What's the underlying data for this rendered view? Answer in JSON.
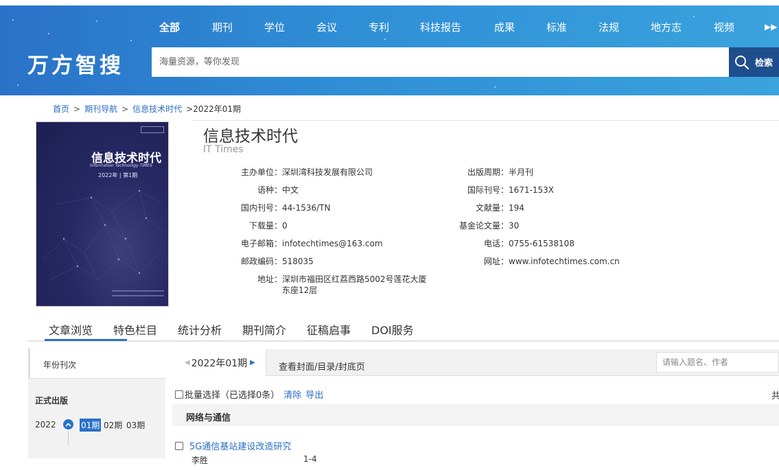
{
  "nav": {
    "items": [
      "全部",
      "期刊",
      "学位",
      "会议",
      "专利",
      "科技报告",
      "成果",
      "标准",
      "法规",
      "地方志",
      "视频"
    ],
    "active_index": 0
  },
  "brand": {
    "logo": "万方智搜"
  },
  "search": {
    "placeholder": "海量资源，等你发现",
    "button_label": "检索"
  },
  "breadcrumb": {
    "home": "首页",
    "journal_nav": "期刊导航",
    "journal": "信息技术时代",
    "current": ">2022年01期"
  },
  "cover": {
    "title": "信息技术时代",
    "subtitle": "Information Technology TIMES",
    "issue": "2022年 | 第1期"
  },
  "journal": {
    "title": "信息技术时代",
    "en_title": "IT Times",
    "info_left": [
      {
        "label": "主办单位：",
        "value": "深圳湾科技发展有限公司"
      },
      {
        "label": "语种：",
        "value": "中文"
      },
      {
        "label": "国内刊号：",
        "value": "44-1536/TN"
      },
      {
        "label": "下载量：",
        "value": "0"
      },
      {
        "label": "电子邮箱：",
        "value": "infotechtimes@163.com"
      },
      {
        "label": "邮政编码：",
        "value": "518035"
      },
      {
        "label": "地址：",
        "value": "深圳市福田区红荔西路5002号莲花大厦",
        "value2": "东座12层"
      }
    ],
    "info_right": [
      {
        "label": "出版周期：",
        "value": "半月刊"
      },
      {
        "label": "国际刊号：",
        "value": "1671-153X"
      },
      {
        "label": "文献量：",
        "value": "194"
      },
      {
        "label": "基金论文量：",
        "value": "30"
      },
      {
        "label": "电话：",
        "value": "0755-61538108"
      },
      {
        "label": "网址：",
        "value": "www.infotechtimes.com.cn"
      }
    ]
  },
  "tabs": [
    "文章浏览",
    "特色栏目",
    "统计分析",
    "期刊简介",
    "征稿启事",
    "DOI服务"
  ],
  "sidebar": {
    "header": "年份刊次",
    "published_label": "正式出版",
    "year": "2022",
    "issues": [
      "01期",
      "02期",
      "03期"
    ],
    "active_issue": 0
  },
  "toolbar": {
    "current_issue": "2022年01期",
    "view_cover": "查看封面/目录/封底页",
    "filter_placeholder": "请输入题名、作者"
  },
  "batch": {
    "label": "批量选择（已选择0条）",
    "clear": "清除",
    "export": "导出",
    "total_prefix": "共"
  },
  "section": {
    "name": "网络与通信"
  },
  "articles": [
    {
      "title": "5G通信基站建设改造研究",
      "author": "李胜",
      "pages": "1-4"
    }
  ],
  "colors": {
    "header_gradient_start": "#2a72c8",
    "header_gradient_end": "#3aa2dd",
    "search_button": "#1e4e8c",
    "link": "#2b6cc4",
    "accent": "#2a72c8"
  }
}
